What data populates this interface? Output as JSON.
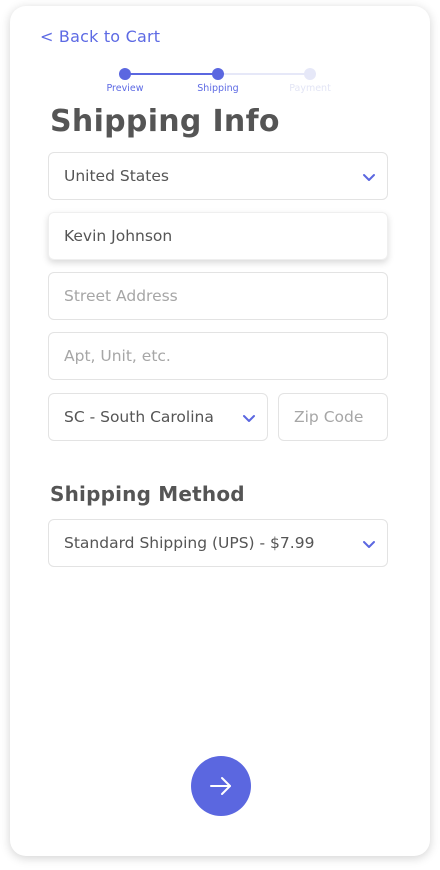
{
  "nav": {
    "back_label": "< Back to Cart"
  },
  "progress": {
    "steps": [
      {
        "label": "Preview",
        "state": "complete"
      },
      {
        "label": "Shipping",
        "state": "current"
      },
      {
        "label": "Payment",
        "state": "upcoming"
      }
    ]
  },
  "form": {
    "title": "Shipping Info",
    "country": {
      "value": "United States",
      "icon": "chevron-down-icon"
    },
    "name": {
      "value": "Kevin Johnson"
    },
    "street": {
      "placeholder": "Street Address"
    },
    "apt": {
      "placeholder": "Apt, Unit, etc."
    },
    "state": {
      "value": "SC - South Carolina",
      "icon": "chevron-down-icon"
    },
    "zip": {
      "placeholder": "Zip Code"
    }
  },
  "shipping_method": {
    "title": "Shipping Method",
    "value": "Standard Shipping (UPS) - $7.99",
    "icon": "chevron-down-icon"
  },
  "next_button": {
    "icon": "arrow-right-icon"
  },
  "colors": {
    "accent": "#5b67e0",
    "text": "#555555",
    "placeholder": "#a6a6a6",
    "border": "#e3e3e3",
    "inactive_step": "#e6e8f8"
  }
}
